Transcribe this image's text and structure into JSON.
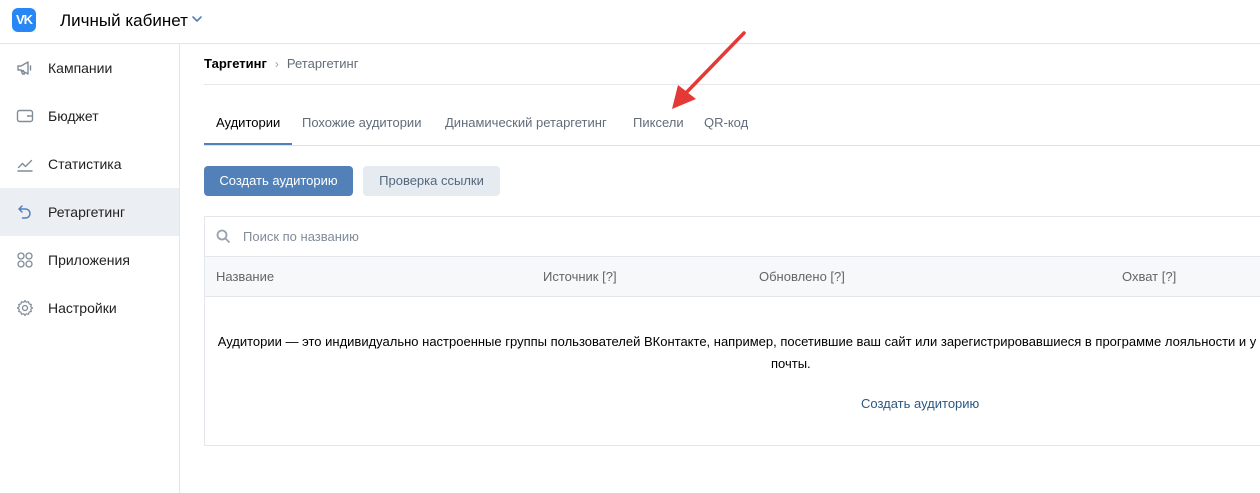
{
  "header": {
    "logo_text": "VK",
    "title": "Личный кабинет"
  },
  "sidebar": {
    "items": [
      {
        "label": "Кампании",
        "icon": "megaphone-icon"
      },
      {
        "label": "Бюджет",
        "icon": "wallet-icon"
      },
      {
        "label": "Статистика",
        "icon": "chart-line-icon"
      },
      {
        "label": "Ретаргетинг",
        "icon": "undo-arrow-icon",
        "active": true
      },
      {
        "label": "Приложения",
        "icon": "apps-grid-icon"
      },
      {
        "label": "Настройки",
        "icon": "gear-icon"
      }
    ]
  },
  "breadcrumb": {
    "first": "Таргетинг",
    "separator": "›",
    "second": "Ретаргетинг"
  },
  "tabs": [
    {
      "label": "Аудитории",
      "active": true
    },
    {
      "label": "Похожие аудитории"
    },
    {
      "label": "Динамический ретаргетинг"
    },
    {
      "label": "Пиксели"
    },
    {
      "label": "QR-код"
    }
  ],
  "actions": {
    "create_label": "Создать аудиторию",
    "check_label": "Проверка ссылки"
  },
  "search": {
    "placeholder": "Поиск по названию"
  },
  "columns": [
    "Название",
    "Источник [?]",
    "Обновлено [?]",
    "Охват [?]"
  ],
  "empty_state": {
    "line1": "Аудитории — это индивидуально настроенные группы пользователей ВКонтакте, например, посетившие ваш сайт или зарегистрировавшиеся в программе лояльности и у",
    "line2": "почты.",
    "link": "Создать аудиторию"
  },
  "colors": {
    "accent": "#5181b8",
    "annotation_arrow": "#e53935",
    "logo": "#2787f5"
  }
}
